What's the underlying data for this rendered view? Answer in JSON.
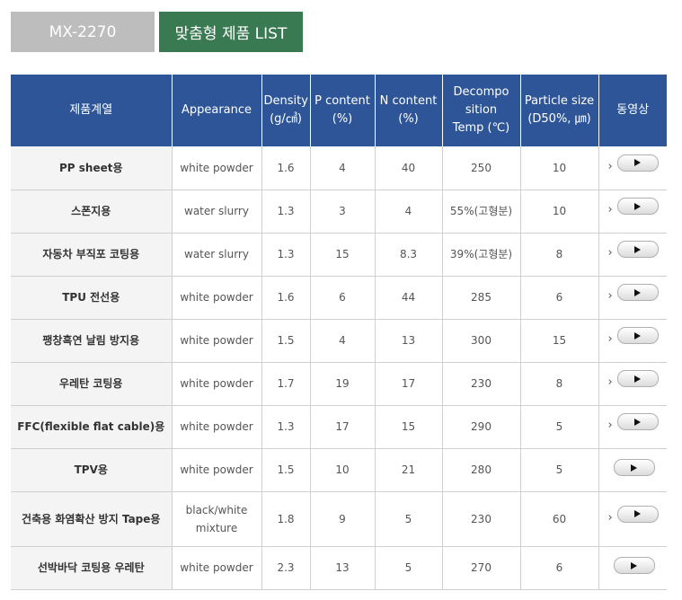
{
  "tabs": {
    "model": "MX-2270",
    "list": "맞춤형 제품 LIST"
  },
  "table": {
    "headers": [
      "제품계열",
      "Appearance",
      "Density\n(g/㎤)",
      "P content\n(%)",
      "N content\n(%)",
      "Decompo\nsition\nTemp (℃)",
      "Particle size\n(D50%, ㎛)",
      "동영상"
    ],
    "rows": [
      {
        "cat": "PP sheet용",
        "appearance": "white powder",
        "density": "1.6",
        "p": "4",
        "n": "40",
        "temp": "250",
        "size": "10",
        "video": "play"
      },
      {
        "cat": "스폰지용",
        "appearance": "water slurry",
        "density": "1.3",
        "p": "3",
        "n": "4",
        "temp": "55%(고형분)",
        "size": "10",
        "video": "play"
      },
      {
        "cat": "자동차 부직포 코팅용",
        "appearance": "water slurry",
        "density": "1.3",
        "p": "15",
        "n": "8.3",
        "temp": "39%(고형분)",
        "size": "8",
        "video": "play"
      },
      {
        "cat": "TPU 전선용",
        "appearance": "white powder",
        "density": "1.6",
        "p": "6",
        "n": "44",
        "temp": "285",
        "size": "6",
        "video": "play"
      },
      {
        "cat": "팽창흑연 날림 방지용",
        "appearance": "white powder",
        "density": "1.5",
        "p": "4",
        "n": "13",
        "temp": "300",
        "size": "15",
        "video": "play"
      },
      {
        "cat": "우레탄 코팅용",
        "appearance": "white powder",
        "density": "1.7",
        "p": "19",
        "n": "17",
        "temp": "230",
        "size": "8",
        "video": "play"
      },
      {
        "cat": "FFC(flexible flat cable)용",
        "appearance": "white powder",
        "density": "1.3",
        "p": "17",
        "n": "15",
        "temp": "290",
        "size": "5",
        "video": "play"
      },
      {
        "cat": "TPV용",
        "appearance": "white powder",
        "density": "1.5",
        "p": "10",
        "n": "21",
        "temp": "280",
        "size": "5",
        "video": "play"
      },
      {
        "cat": "건축용 화염확산 방지 Tape용",
        "appearance": "black/white\nmixture",
        "density": "1.8",
        "p": "9",
        "n": "5",
        "temp": "230",
        "size": "60",
        "video": "play"
      },
      {
        "cat": "선박바닥 코팅용 우레탄",
        "appearance": "white powder",
        "density": "2.3",
        "p": "13",
        "n": "5",
        "temp": "270",
        "size": "6",
        "video": "play"
      }
    ]
  },
  "colors": {
    "header_bg": "#2e5597",
    "tab_active": "#3a7a52",
    "tab_inactive": "#bdbdbd",
    "category_bg": "#f4f4f4"
  },
  "icons": {
    "play": "play-icon",
    "arrow": "chevron-right-icon"
  }
}
